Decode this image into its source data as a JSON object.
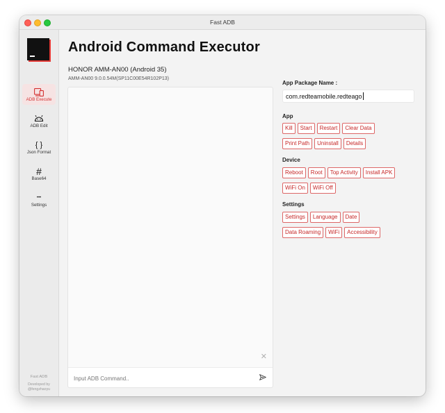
{
  "window": {
    "title": "Fast ADB"
  },
  "sidebar": {
    "items": [
      {
        "label": "ADB Execute",
        "icon": "devices-icon",
        "active": true
      },
      {
        "label": "ADB Edit",
        "icon": "android-icon",
        "active": false
      },
      {
        "label": "Json Format",
        "icon": "braces-icon",
        "glyph": "{ }",
        "active": false
      },
      {
        "label": "Base64",
        "icon": "hash-icon",
        "glyph": "#",
        "active": false
      },
      {
        "label": "Settings",
        "icon": "more-icon",
        "glyph": "•••",
        "active": false
      }
    ],
    "footer": {
      "app_name": "Fast ADB",
      "developed_by": "Developed by",
      "author": "@fengzhaoyu"
    }
  },
  "main": {
    "title": "Android Command Executor",
    "device": {
      "name": "HONOR AMM-AN00 (Android 35)",
      "details": "AMM-AN00 9.0.0.54M(SP11C00E54R102P13)"
    },
    "console": {
      "clear_glyph": "✕",
      "input_value": "",
      "input_placeholder": "Input ADB Command.."
    }
  },
  "panel": {
    "package_label": "App Package Name :",
    "package_value": "com.redteamobile.redteago",
    "app_section": "App",
    "app_buttons_row1": [
      "Kill",
      "Start",
      "Restart",
      "Clear Data"
    ],
    "app_buttons_row2": [
      "Print Path",
      "Uninstall",
      "Details"
    ],
    "device_section": "Device",
    "device_buttons_row1": [
      "Reboot",
      "Root",
      "Top Activity",
      "Install APK"
    ],
    "device_buttons_row2": [
      "WiFi On",
      "WiFi Off"
    ],
    "settings_section": "Settings",
    "settings_buttons_row1": [
      "Settings",
      "Language",
      "Date"
    ],
    "settings_buttons_row2": [
      "Data Roaming",
      "WiFi",
      "Accessibility"
    ]
  },
  "colors": {
    "accent": "#d32f2f",
    "button_border": "#dd6666",
    "active_nav_bg": "#f6e3e3"
  }
}
